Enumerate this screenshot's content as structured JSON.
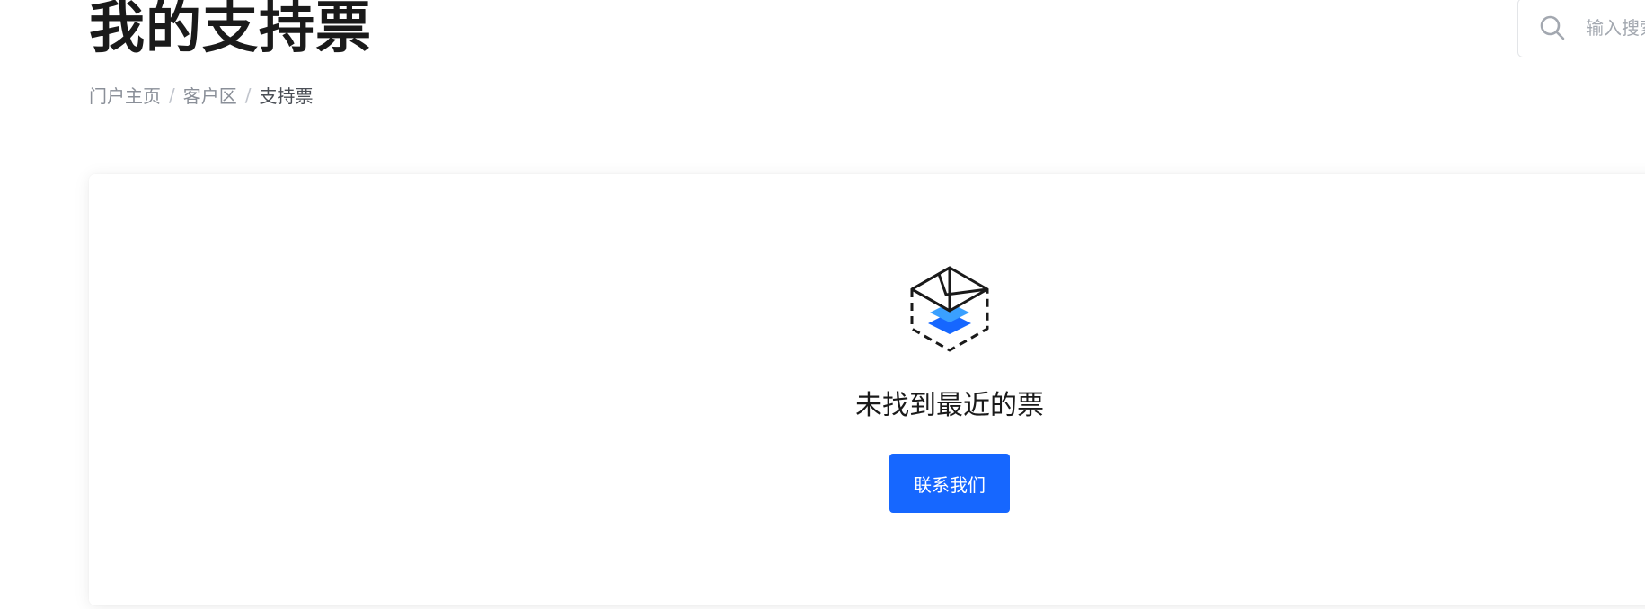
{
  "header": {
    "title": "我的支持票",
    "breadcrumb": [
      "门户主页",
      "客户区",
      "支持票"
    ],
    "breadcrumb_separator": "/"
  },
  "search": {
    "placeholder": "输入搜索",
    "icon": "search-icon"
  },
  "empty_state": {
    "icon": "open-envelope-box-icon",
    "message": "未找到最近的票",
    "button_label": "联系我们"
  },
  "colors": {
    "accent": "#1667ff",
    "title": "#1a1a1a",
    "muted": "#8a8f98"
  }
}
